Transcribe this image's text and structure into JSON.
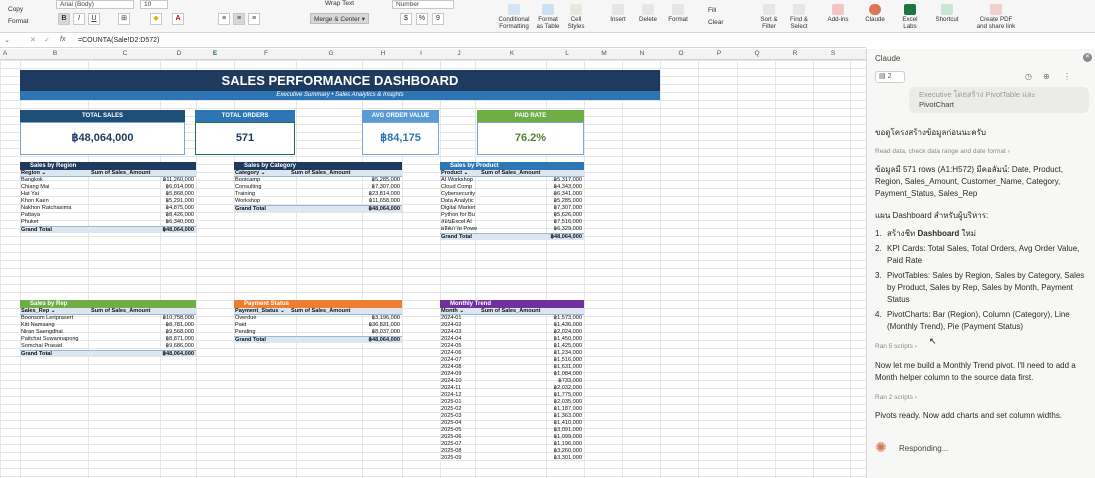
{
  "ribbon": {
    "copy": "Copy",
    "format": "Format",
    "font_name": "Arial (Body)",
    "font_size": "10",
    "wrap_text": "Wrap Text",
    "merge_center": "Merge & Center",
    "number_format": "Number",
    "fill": "Fill",
    "clear": "Clear",
    "buttons": [
      {
        "label": "Conditional\nFormatting",
        "icon": "conditional-formatting-icon"
      },
      {
        "label": "Format\nas Table",
        "icon": "format-as-table-icon"
      },
      {
        "label": "Cell\nStyles",
        "icon": "cell-styles-icon"
      },
      {
        "label": "Insert",
        "icon": "insert-icon"
      },
      {
        "label": "Delete",
        "icon": "delete-icon"
      },
      {
        "label": "Format",
        "icon": "format-cells-icon"
      },
      {
        "label": "Sort &\nFilter",
        "icon": "sort-filter-icon"
      },
      {
        "label": "Find &\nSelect",
        "icon": "find-select-icon"
      },
      {
        "label": "Add-ins",
        "icon": "add-ins-icon"
      },
      {
        "label": "Claude",
        "icon": "claude-icon"
      },
      {
        "label": "Excel\nLabs",
        "icon": "excel-labs-icon"
      },
      {
        "label": "Shortcut",
        "icon": "shortcut-icon"
      },
      {
        "label": "Create PDF\nand share link",
        "icon": "create-pdf-icon"
      }
    ]
  },
  "formula": {
    "cell_ref": "",
    "fx": "fx",
    "text": "=COUNTA(Sale!D2:D572)"
  },
  "columns": [
    "A",
    "B",
    "C",
    "D",
    "E",
    "F",
    "G",
    "H",
    "I",
    "J",
    "K",
    "L",
    "M",
    "N",
    "O",
    "P",
    "Q",
    "R",
    "S"
  ],
  "dashboard": {
    "title": "SALES PERFORMANCE DASHBOARD",
    "subtitle": "Executive Summary  •  Sales Analytics & Insights",
    "kpis": [
      {
        "label": "TOTAL SALES",
        "value": "฿48,064,000",
        "color": "#1f4e79"
      },
      {
        "label": "TOTAL ORDERS",
        "value": "571",
        "color": "#2e75b6"
      },
      {
        "label": "AVG ORDER VALUE",
        "value": "฿84,175",
        "color": "#5b9bd5"
      },
      {
        "label": "PAID RATE",
        "value": "76.2%",
        "color": "#70ad47"
      }
    ]
  },
  "pivots": {
    "region": {
      "title": "Sales by Region",
      "color": "#1f3a5f",
      "h1": "Region",
      "h2": "Sum of Sales_Amount",
      "rows": [
        [
          "Bangkok",
          "฿11,260,000"
        ],
        [
          "Chiang Mai",
          "฿6,014,000"
        ],
        [
          "Hat Yai",
          "฿5,868,000"
        ],
        [
          "Khon Kaen",
          "฿5,291,000"
        ],
        [
          "Nakhon Ratchasima",
          "฿4,875,000"
        ],
        [
          "Pattaya",
          "฿8,426,000"
        ],
        [
          "Phuket",
          "฿6,340,000"
        ]
      ],
      "total": [
        "Grand Total",
        "฿48,064,000"
      ]
    },
    "category": {
      "title": "Sales by Category",
      "color": "#1f3a5f",
      "h1": "Category",
      "h2": "Sum of Sales_Amount",
      "rows": [
        [
          "Bootcamp",
          "฿5,285,000"
        ],
        [
          "Consulting",
          "฿7,307,000"
        ],
        [
          "Training",
          "฿23,814,000"
        ],
        [
          "Workshop",
          "฿11,658,000"
        ]
      ],
      "total": [
        "Grand Total",
        "฿48,064,000"
      ]
    },
    "product": {
      "title": "Sales by Product",
      "color": "#2e75b6",
      "h1": "Product",
      "h2": "Sum of Sales_Amount",
      "rows": [
        [
          "AI Workshop",
          "฿5,317,000"
        ],
        [
          "Cloud Comp",
          "฿4,343,000"
        ],
        [
          "Cybersecurity",
          "฿6,341,000"
        ],
        [
          "Data Analytic",
          "฿5,285,000"
        ],
        [
          "Digital Market",
          "฿7,307,000"
        ],
        [
          "Python for Bu",
          "฿5,626,000"
        ],
        [
          "สอนExcel AI",
          "฿7,516,000"
        ],
        [
          "ผลิตภาพ Powe",
          "฿6,329,000"
        ]
      ],
      "total": [
        "Grand Total",
        "฿48,064,000"
      ]
    },
    "rep": {
      "title": "Sales by Rep",
      "color": "#70ad47",
      "h1": "Sales_Rep",
      "h2": "Sum of Sales_Amount",
      "rows": [
        [
          "Boonsom Lertprasert",
          "฿10,758,000"
        ],
        [
          "Kitt Namsang",
          "฿8,781,000"
        ],
        [
          "Niran Saengdhal",
          "฿9,568,000"
        ],
        [
          "Paitchat Suwannapong",
          "฿8,871,000"
        ],
        [
          "Somchai Prasad",
          "฿9,686,000"
        ]
      ],
      "total": [
        "Grand Total",
        "฿48,064,000"
      ]
    },
    "payment": {
      "title": "Payment Status",
      "color": "#ed7d31",
      "h1": "Payment_Status",
      "h2": "Sum of Sales_Amount",
      "rows": [
        [
          "Overdue",
          "฿3,196,000"
        ],
        [
          "Paid",
          "฿36,831,000"
        ],
        [
          "Pending",
          "฿8,037,000"
        ]
      ],
      "total": [
        "Grand Total",
        "฿48,064,000"
      ]
    },
    "trend": {
      "title": "Monthly Trend",
      "color": "#7030a0",
      "h1": "Month",
      "h2": "Sum of Sales_Amount",
      "rows": [
        [
          "2024-01",
          "฿1,573,000"
        ],
        [
          "2024-02",
          "฿1,436,000"
        ],
        [
          "2024-03",
          "฿2,024,000"
        ],
        [
          "2024-04",
          "฿1,450,000"
        ],
        [
          "2024-05",
          "฿1,425,000"
        ],
        [
          "2024-06",
          "฿1,234,000"
        ],
        [
          "2024-07",
          "฿1,516,000"
        ],
        [
          "2024-08",
          "฿1,631,000"
        ],
        [
          "2024-09",
          "฿1,084,000"
        ],
        [
          "2024-10",
          "฿733,000"
        ],
        [
          "2024-11",
          "฿2,032,000"
        ],
        [
          "2024-12",
          "฿1,775,000"
        ],
        [
          "2025-01",
          "฿2,035,000"
        ],
        [
          "2025-02",
          "฿1,187,000"
        ],
        [
          "2025-03",
          "฿1,363,000"
        ],
        [
          "2025-04",
          "฿1,410,000"
        ],
        [
          "2025-05",
          "฿3,091,000"
        ],
        [
          "2025-06",
          "฿1,099,000"
        ],
        [
          "2025-07",
          "฿1,196,000"
        ],
        [
          "2025-08",
          "฿3,260,000"
        ],
        [
          "2025-09",
          "฿3,301,000"
        ]
      ]
    }
  },
  "panel": {
    "title": "Claude",
    "badge": "2",
    "quoted_1": "Executive โดยสร้าง PivotTable และ",
    "quoted_2": "PivotChart",
    "t1": "ขอดูโครงสร้างข้อมูลก่อนนะครับ",
    "step1": "Read data, check data range and date format",
    "t2": "ข้อมูลมี 571 rows (A1:H572) มีคอลัมน์: Date, Product, Region, Sales_Amount, Customer_Name, Category, Payment_Status, Sales_Rep",
    "t3": "แผน Dashboard สำหรับผู้บริหาร:",
    "plan": [
      {
        "n": "1.",
        "pre": "สร้างชีท ",
        "bold": "Dashboard",
        "post": " ใหม่"
      },
      {
        "n": "2.",
        "pre": "KPI Cards: Total Sales, Total Orders, Avg Order Value, Paid Rate",
        "bold": "",
        "post": ""
      },
      {
        "n": "3.",
        "pre": "PivotTables: Sales by Region, Sales by Category, Sales by Product, Sales by Rep, Sales by Month, Payment Status",
        "bold": "",
        "post": ""
      },
      {
        "n": "4.",
        "pre": "PivotCharts: Bar (Region), Column (Category), Line (Monthly Trend), Pie (Payment Status)",
        "bold": "",
        "post": ""
      }
    ],
    "step2": "Ran 5 scripts",
    "t4": "Now let me build a Monthly Trend pivot. I'll need to add a Month helper column to the source data first.",
    "step3": "Ran 2 scripts",
    "t5": "Pivots ready. Now add charts and set column widths.",
    "status": "Responding..."
  }
}
